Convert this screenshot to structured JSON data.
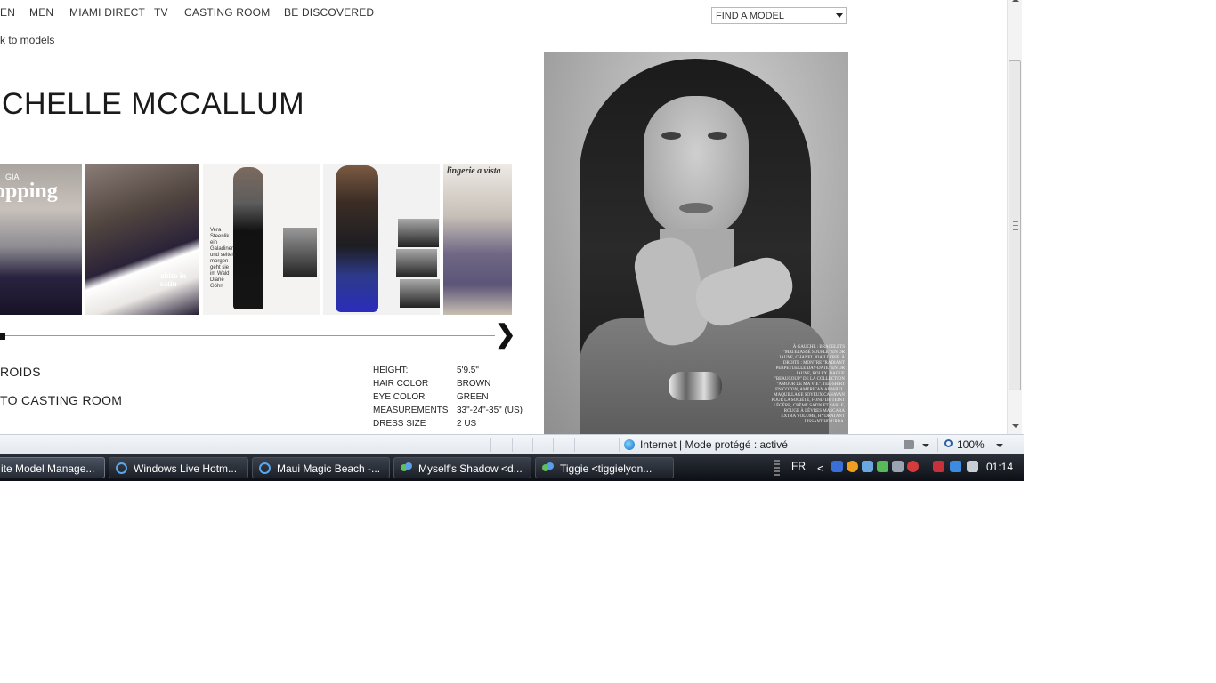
{
  "nav": {
    "items": [
      "EN",
      "MEN",
      "MIAMI DIRECT",
      "TV",
      "CASTING ROOM",
      "BE DISCOVERED"
    ],
    "back_link": "k to models",
    "find_select_value": "FIND A MODEL"
  },
  "model": {
    "name": "CHELLE MCCALLUM",
    "thumb_texts": {
      "t1_small": "GIA",
      "t1_headline": "opping",
      "t2_caption": "abito in satin",
      "t3_text": "Vera Steenlik ein Galadiner und selten morgen geht sie im Wald Diane Göhn",
      "t5_headline": "lingerie a vista"
    },
    "links": {
      "polaroids": "ROIDS",
      "casting_room": "TO CASTING ROOM"
    },
    "stats": [
      {
        "label": "HEIGHT:",
        "value": "5'9.5\""
      },
      {
        "label": "HAIR COLOR",
        "value": "BROWN"
      },
      {
        "label": "EYE COLOR",
        "value": "GREEN"
      },
      {
        "label": "MEASUREMENTS",
        "value": "33\"-24\"-35\" (US)"
      },
      {
        "label": "DRESS SIZE",
        "value": "2 US"
      }
    ],
    "photo_caption": "À GAUCHE : BRACELETS \"MATELASSÉ SOUPLE\" EN OR JAUNE, CHANEL JOAILLERIE. À DROITE : MONTRE \"RADIANT PERPETUELLE DAY-DATE\" EN OR JAUNE, ROLEX. BAGUE \"BEAUCOUP\" DE LA COLLECTION \"AMOUR DE MA VIE\". TEE-SHIRT EN COTON, AMERICAN APPAREL. MAQUILLAGE SOYEUX CANAVAN POUR LA SOCIÉTÉ, FOND DE TEINT LÉGÈRE, CRÈME SATIN ET SABLE, ROUGE À LÈVRES MASCARA EXTRA VOLUME, HYDRATANT LISSANT HD URBA."
  },
  "statusbar": {
    "zone": "Internet | Mode protégé : activé",
    "zoom": "100%"
  },
  "taskbar": {
    "tasks": [
      {
        "label": "ite Model Manage..."
      },
      {
        "label": "Windows Live Hotm..."
      },
      {
        "label": "Maui Magic Beach -..."
      },
      {
        "label": "Myself's Shadow <d..."
      },
      {
        "label": "Tiggie <tiggielyon..."
      }
    ],
    "lang": "FR",
    "chevron": "<",
    "clock": "01:14"
  },
  "ui": {
    "next_arrow": "❯"
  },
  "colors": {
    "taskbar": "#1c2028",
    "statusbar": "#e3e8ee",
    "text": "#222222"
  }
}
